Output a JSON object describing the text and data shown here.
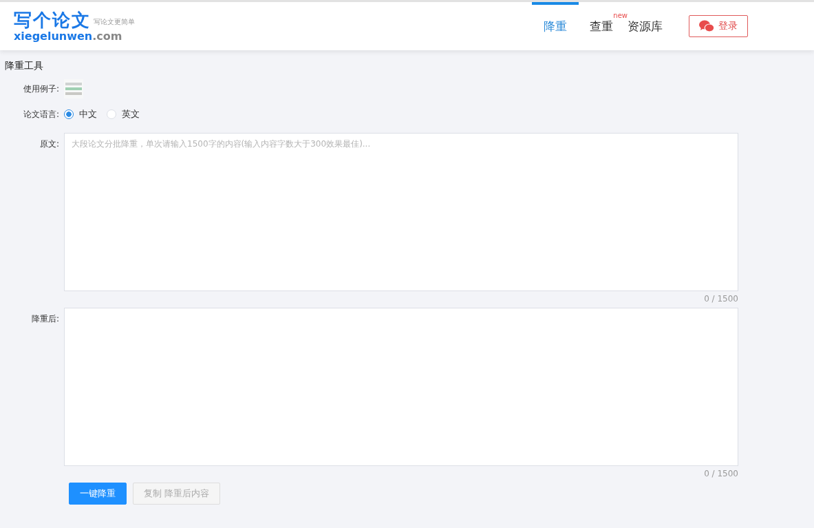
{
  "header": {
    "logo": {
      "title": "写个论文",
      "tagline": "写论文更简单",
      "domain_main": "xiegelunwen",
      "domain_tld": ".com"
    },
    "nav": [
      {
        "label": "降重",
        "selected": true
      },
      {
        "label": "查重",
        "selected": false,
        "badge": "new"
      },
      {
        "label": "资源库",
        "selected": false
      }
    ],
    "login_button": "登录"
  },
  "page_title": "降重工具",
  "example_label": "使用例子:",
  "language": {
    "label": "论文语言:",
    "options": [
      {
        "label": "中文",
        "selected": true
      },
      {
        "label": "英文",
        "selected": false
      }
    ]
  },
  "source": {
    "label": "原文:",
    "placeholder": "大段论文分批降重，单次请输入1500字的内容(输入内容字数大于300效果最佳)...",
    "counter": "0 / 1500"
  },
  "result": {
    "label": "降重后:",
    "counter": "0 / 1500"
  },
  "buttons": [
    {
      "label": "一键降重",
      "disabled": false
    },
    {
      "label": "复制 降重后内容",
      "disabled": true
    }
  ]
}
